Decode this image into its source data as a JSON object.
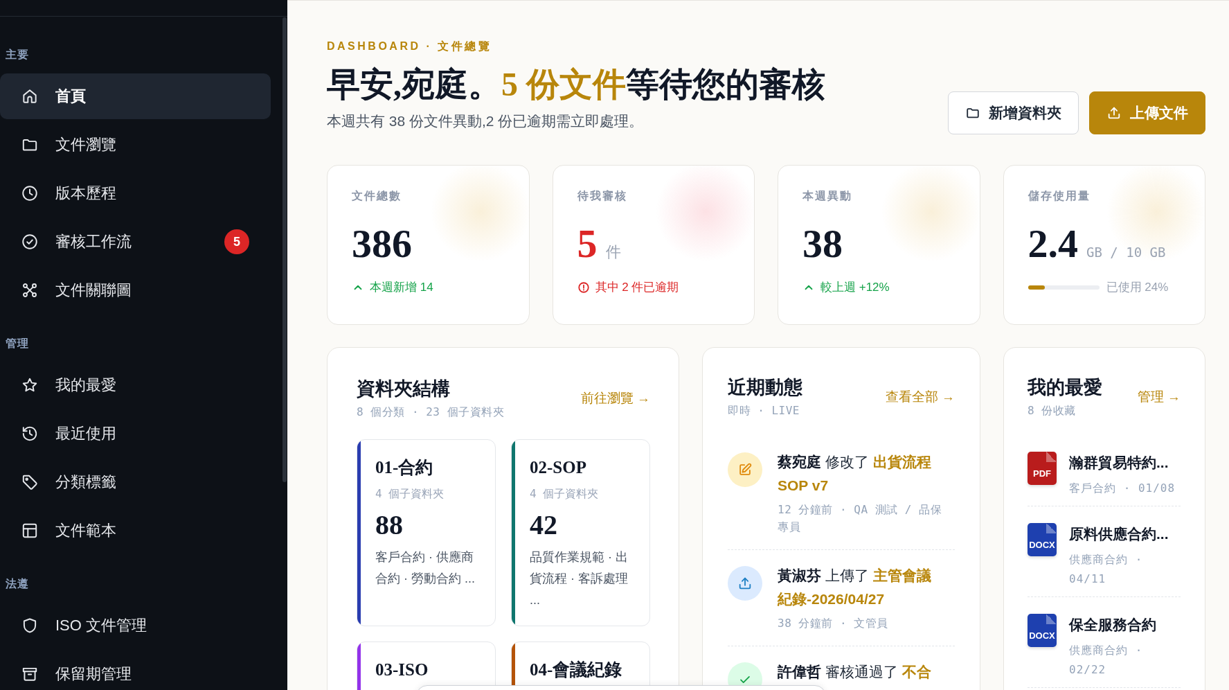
{
  "sidebar": {
    "sections": [
      {
        "label": "主要",
        "items": [
          {
            "label": "首頁",
            "selected": true
          },
          {
            "label": "文件瀏覽",
            "selected": false
          },
          {
            "label": "版本歷程",
            "selected": false
          },
          {
            "label": "審核工作流",
            "selected": false,
            "badge": "5"
          },
          {
            "label": "文件關聯圖",
            "selected": false
          }
        ]
      },
      {
        "label": "管理",
        "items": [
          {
            "label": "我的最愛",
            "selected": false
          },
          {
            "label": "最近使用",
            "selected": false
          },
          {
            "label": "分類標籤",
            "selected": false
          },
          {
            "label": "文件範本",
            "selected": false
          }
        ]
      },
      {
        "label": "法遵",
        "items": [
          {
            "label": "ISO 文件管理",
            "selected": false
          },
          {
            "label": "保留期管理",
            "selected": false
          }
        ]
      }
    ]
  },
  "header": {
    "eyebrow": "DASHBOARD · 文件總覽",
    "title": {
      "before": "早安,宛庭。",
      "highlight": "5 份文件",
      "after": "等待您的審核"
    },
    "subtitle": "本週共有 38 份文件異動,2 份已逾期需立即處理。",
    "buttons": [
      {
        "label": "新增資料夾",
        "kind": "secondary"
      },
      {
        "label": "上傳文件",
        "kind": "primary"
      }
    ]
  },
  "stats": [
    {
      "label": "文件總數",
      "value": "386",
      "note": "本週新增 14",
      "kind": "up"
    },
    {
      "label": "待我審核",
      "value": "5",
      "unit": "件",
      "note": "其中 2 件已逾期",
      "kind": "alert"
    },
    {
      "label": "本週異動",
      "value": "38",
      "note": "較上週 +12%",
      "kind": "up"
    },
    {
      "label": "儲存使用量",
      "value": "2.4",
      "unit": "GB / 10 GB",
      "level": 0.24,
      "note": "已使用 24%",
      "kind": "meter"
    }
  ],
  "folders": {
    "title": "資料夾結構",
    "subtitle": "8 個分類 · 23 個子資料夾",
    "link": "前往瀏覽 →",
    "items": [
      {
        "name": "01-合約",
        "count": "4 個子資料夾",
        "total": "88",
        "desc": "客戶合約 · 供應商合約 · 勞動合約 ...",
        "color": "#2a3db0"
      },
      {
        "name": "02-SOP",
        "count": "4 個子資料夾",
        "total": "42",
        "desc": "品質作業規範 · 出貨流程 · 客訴處理 ...",
        "color": "#0f766e"
      },
      {
        "name": "03-ISO",
        "color": "#9333ea"
      },
      {
        "name": "04-會議紀錄",
        "color": "#b45309"
      }
    ]
  },
  "activity": {
    "title": "近期動態",
    "subtitle": "即時 · LIVE",
    "link": "查看全部 →",
    "items": [
      {
        "actor": "蔡宛庭",
        "action": "修改了",
        "target": "出貨流程 SOP v7",
        "meta": "12 分鐘前 · QA 測試 / 品保專員",
        "kind": "edit"
      },
      {
        "actor": "黃淑芬",
        "action": "上傳了",
        "target": "主管會議紀錄-2026/04/27",
        "meta": "38 分鐘前 · 文管員",
        "kind": "upload"
      },
      {
        "actor": "許偉哲",
        "action": "審核通過了",
        "target": "不合",
        "kind": "approve"
      }
    ]
  },
  "favorites": {
    "title": "我的最愛",
    "subtitle": "8 份收藏",
    "link": "管理 →",
    "items": [
      {
        "kind": "pdf",
        "badge": "PDF",
        "name": "瀚群貿易特約...",
        "meta": "客戶合約 · 01/08"
      },
      {
        "kind": "docx",
        "badge": "DOCX",
        "name": "原料供應合約...",
        "meta": "供應商合約 · 04/11"
      },
      {
        "kind": "docx",
        "badge": "DOCX",
        "name": "保全服務合約",
        "meta": "供應商合約 · 02/22"
      }
    ]
  }
}
